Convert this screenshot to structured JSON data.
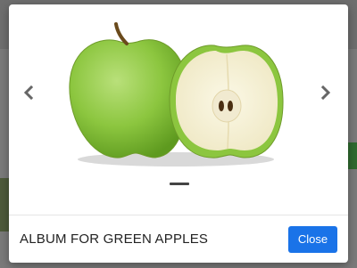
{
  "modal": {
    "title": "ALBUM FOR GREEN APPLES",
    "close_label": "Close",
    "carousel": {
      "slide_icon": "green-apple-image",
      "prev_icon": "chevron-left-icon",
      "next_icon": "chevron-right-icon",
      "indicator_count": 1,
      "active_index": 0
    }
  },
  "colors": {
    "primary_button": "#1a73e8",
    "overlay": "#7a7a7a",
    "apple_green": "#8cc63f"
  }
}
